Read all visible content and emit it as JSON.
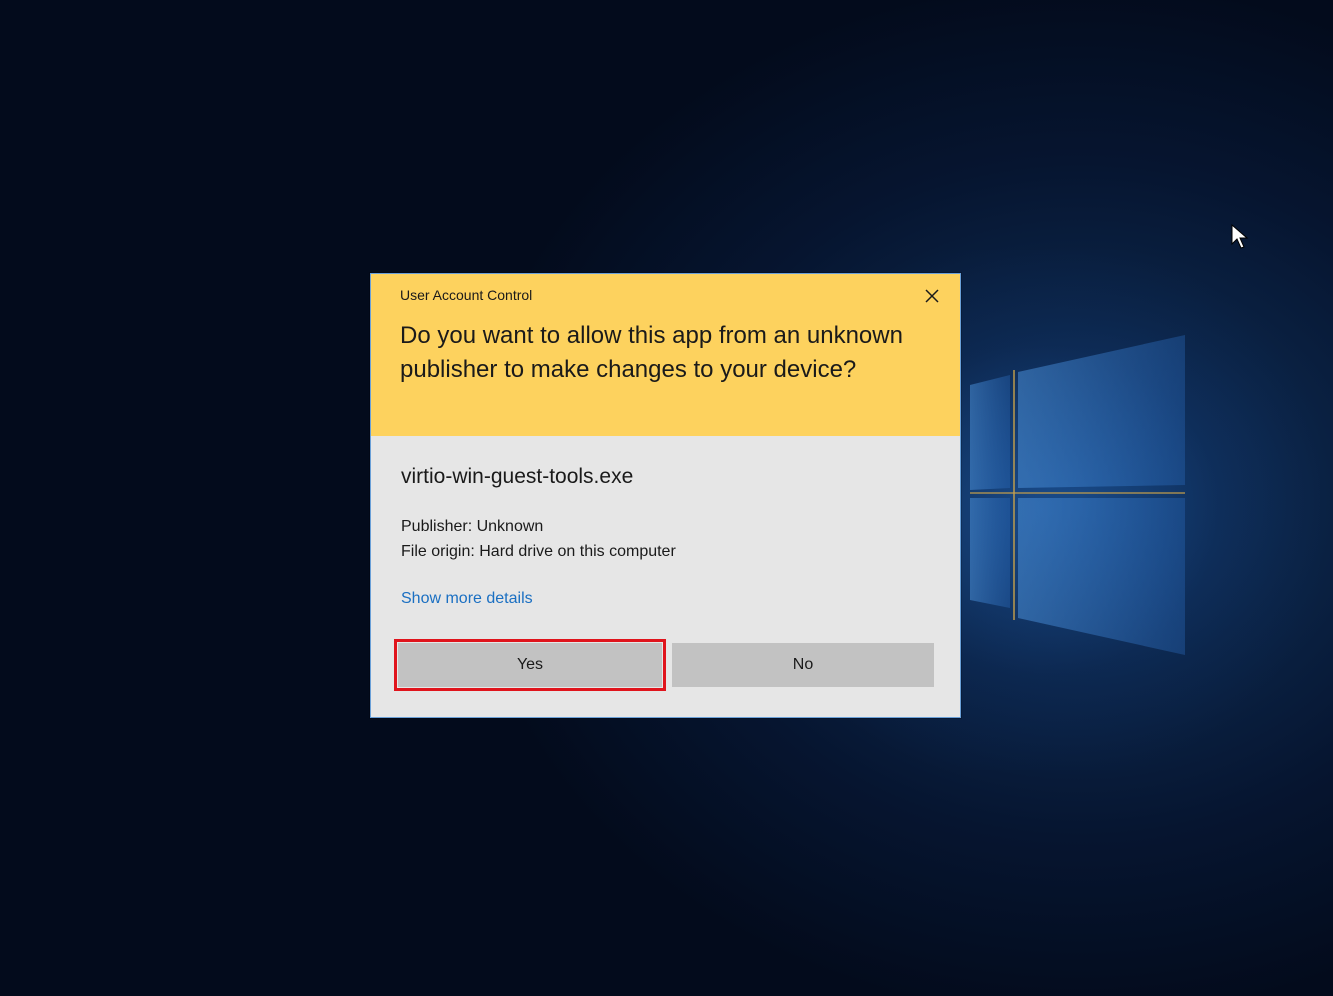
{
  "dialog": {
    "title": "User Account Control",
    "question": "Do you want to allow this app from an unknown publisher to make changes to your device?",
    "app_name": "virtio-win-guest-tools.exe",
    "publisher": "Publisher: Unknown",
    "file_origin": "File origin: Hard drive on this computer",
    "more_details": "Show more details",
    "yes_label": "Yes",
    "no_label": "No"
  },
  "colors": {
    "header_bg": "#fdd25e",
    "body_bg": "#e6e6e6",
    "button_bg": "#c2c2c2",
    "link": "#1a6fc2",
    "highlight": "#e0141c"
  },
  "icons": {
    "close": "close-icon",
    "cursor": "mouse-pointer-icon",
    "logo": "windows-logo-icon"
  }
}
